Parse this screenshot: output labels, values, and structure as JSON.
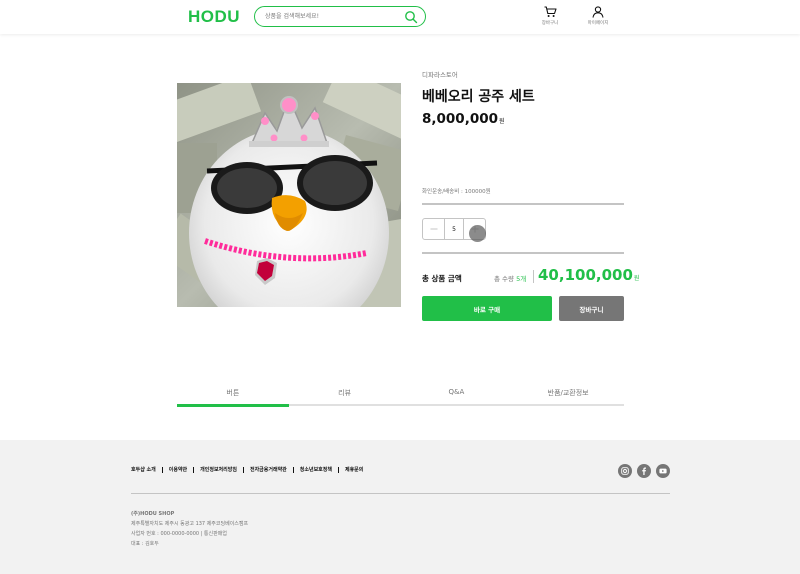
{
  "header": {
    "logo": "HODU",
    "search_placeholder": "상품을 검색해보세요!",
    "cart_label": "장바구니",
    "mypage_label": "마이페이지"
  },
  "product": {
    "seller": "디파라스토어",
    "name": "베베오리 공주 세트",
    "price": "8,000,000",
    "price_unit": "원",
    "shipping": "화인운송/배송비 : 100000원",
    "quantity": "5",
    "total_label": "총 상품 금액",
    "total_qty_prefix": "총 수량 ",
    "total_qty_value": "5개",
    "total_price": "40,100,000",
    "total_unit": "원",
    "buy_label": "바로 구매",
    "cart_label": "장바구니"
  },
  "tabs": [
    {
      "label": "버튼",
      "active": true
    },
    {
      "label": "리뷰",
      "active": false
    },
    {
      "label": "Q&A",
      "active": false
    },
    {
      "label": "반품/교환정보",
      "active": false
    }
  ],
  "footer": {
    "links": [
      "호두샵 소개",
      "이용약관",
      "개인정보처리방침",
      "전자금융거래약관",
      "청소년보호정책",
      "제휴문의"
    ],
    "social_icons": [
      "instagram-icon",
      "facebook-icon",
      "youtube-icon"
    ],
    "company": "(주)HODU SHOP",
    "address": "제주특별자치도 제주시 동광고 137 제주코딩베이스캠프",
    "business_no": "사업자 번호 : 000-0000-0000 | 통신판매업",
    "ceo": "대표 : 김호두"
  },
  "colors": {
    "accent": "#21bf48",
    "secondary_button": "#767676",
    "footer_bg": "#f2f2f2"
  }
}
